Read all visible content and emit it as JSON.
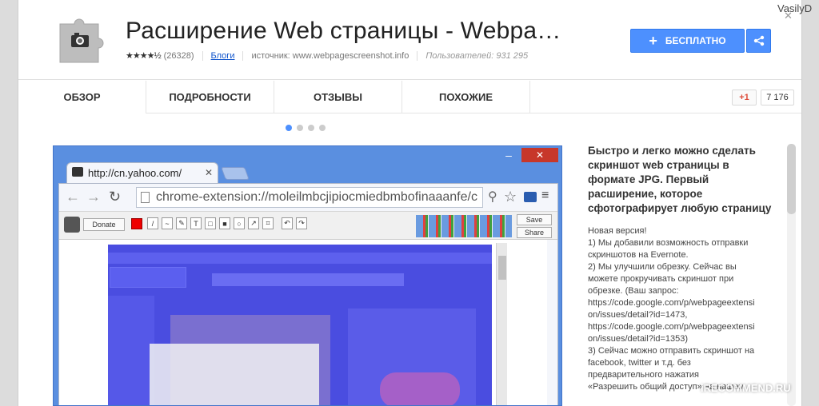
{
  "header": {
    "title": "Расширение Web страницы - Webpa…",
    "rating_count": "(26328)",
    "blogs_link": "Блоги",
    "source": "источник: www.webpagescreenshot.info",
    "users": "Пользователей: 931 295",
    "install_button": "БЕСПЛАТНО",
    "stars": "★★★★½"
  },
  "tabs": [
    {
      "label": "ОБЗОР"
    },
    {
      "label": "ПОДРОБНОСТИ"
    },
    {
      "label": "ОТЗЫВЫ"
    },
    {
      "label": "ПОХОЖИЕ"
    }
  ],
  "social": {
    "gplus_label": "+1",
    "gplus_count": "7 176"
  },
  "carousel": {
    "active_index": 0,
    "count": 4
  },
  "screenshot": {
    "tab_title": "http://cn.yahoo.com/",
    "omnibox": "chrome-extension://moleilmbcjipiocmiedbmbofinaaanfe/c",
    "donate": "Donate",
    "save": "Save",
    "share": "Share"
  },
  "description": {
    "heading": "Быстро и легко можно сделать скриншот web страницы в формате JPG. Первый расширение, которое сфотографирует любую страницу",
    "lines": [
      "Новая версия!",
      "1) Мы добавили возможность отправки",
      "скриншотов на Evernote.",
      "2) Мы улучшили обрезку. Сейчас вы",
      "можете прокручивать скриншот при",
      "обрезке. (Ваш запрос:",
      "https://code.google.com/p/webpageextensi",
      "on/issues/detail?id=1473,",
      "https://code.google.com/p/webpageextensi",
      "on/issues/detail?id=1353)",
      "3) Сейчас можно отправить скриншот на",
      "facebook, twitter и т.д. без",
      "предварительного нажатия",
      "«Разрешить общий доступ» на нашем"
    ]
  },
  "overlay": {
    "username": "VasilyD",
    "watermark": "iRECOMMEND.RU"
  },
  "colors": {
    "accent": "#4d90fe",
    "tab_active": "#ffffff",
    "window_close": "#c7372a",
    "blue_overlay": "#4a4de0"
  }
}
